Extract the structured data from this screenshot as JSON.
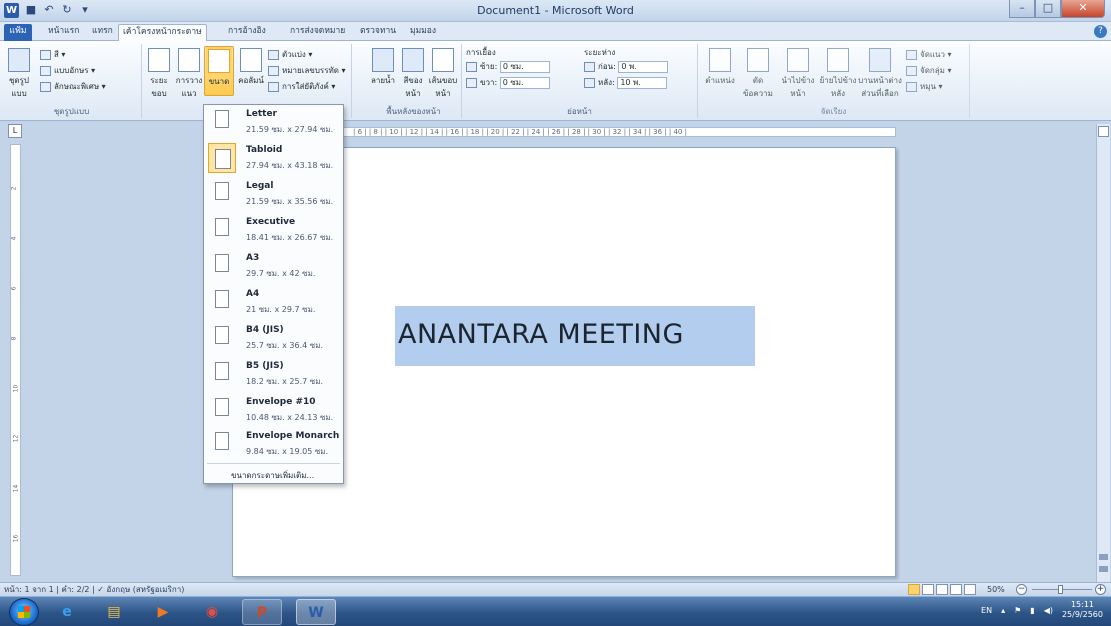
{
  "window": {
    "title": "Document1 - Microsoft Word",
    "icon": "word-app-icon"
  },
  "quick_access": [
    {
      "name": "save-icon",
      "glyph": "■"
    },
    {
      "name": "undo-icon",
      "glyph": "↶"
    },
    {
      "name": "redo-icon",
      "glyph": "↻"
    },
    {
      "name": "customize-qat-icon",
      "glyph": "▾"
    }
  ],
  "tabs": [
    {
      "id": "file",
      "label": "แฟ้ม"
    },
    {
      "id": "home",
      "label": "หน้าแรก"
    },
    {
      "id": "insert",
      "label": "แทรก"
    },
    {
      "id": "page-layout",
      "label": "เค้าโครงหน้ากระดาษ"
    },
    {
      "id": "references",
      "label": "การอ้างอิง"
    },
    {
      "id": "mailings",
      "label": "การส่งจดหมาย"
    },
    {
      "id": "review",
      "label": "ตรวจทาน"
    },
    {
      "id": "view",
      "label": "มุมมอง"
    }
  ],
  "ribbon": {
    "themes": {
      "label": "ชุดรูปแบบ",
      "themes_button": "ชุดรูปแบบ",
      "colors": "สี",
      "fonts": "แบบอักษร",
      "effects": "ลักษณะพิเศษ"
    },
    "page_setup": {
      "margins": "ระยะขอบ",
      "orientation": "การวางแนว",
      "size": "ขนาด",
      "columns": "คอลัมน์",
      "breaks": "ตัวแบ่ง",
      "line_numbers": "หมายเลขบรรทัด",
      "hyphenation": "การใส่ยัติภังค์"
    },
    "page_background": {
      "label": "พื้นหลังของหน้า",
      "watermark": "ลายน้ำ",
      "page_color": "สีของหน้า",
      "page_borders": "เส้นขอบหน้า"
    },
    "paragraph": {
      "label": "ย่อหน้า",
      "indent": "การเยื้อง",
      "left_label": "ซ้าย:",
      "left_value": "0 ซม.",
      "right_label": "ขวา:",
      "right_value": "0 ซม.",
      "spacing": "ระยะห่าง",
      "before_label": "ก่อน:",
      "before_value": "0 พ.",
      "after_label": "หลัง:",
      "after_value": "10 พ."
    },
    "arrange": {
      "label": "จัดเรียง",
      "position": "ตำแหน่ง",
      "wrap_text": "ตัดข้อความ",
      "bring_forward": "นำไปข้างหน้า",
      "send_backward": "ย้ายไปข้างหลัง",
      "selection_pane": "บานหน้าต่างส่วนที่เลือก",
      "align": "จัดแนว",
      "group": "จัดกลุ่ม",
      "rotate": "หมุน"
    }
  },
  "ruler": {
    "ticks": "| 6 |  | 8 |  | 10 |  | 12 |  | 14 |  | 16 |  | 18 |  | 20 |  | 22 |  | 24 |  | 26 |  | 28 |  | 30 |  | 32 |  | 34 |  | 36 |  | 40 |"
  },
  "document": {
    "text": "ANANTARA MEETING"
  },
  "size_menu": {
    "items": [
      {
        "name": "Letter",
        "dims": "21.59 ซม. x 27.94 ซม.",
        "selected": false
      },
      {
        "name": "Tabloid",
        "dims": "27.94 ซม. x 43.18 ซม.",
        "selected": true
      },
      {
        "name": "Legal",
        "dims": "21.59 ซม. x 35.56 ซม.",
        "selected": false
      },
      {
        "name": "Executive",
        "dims": "18.41 ซม. x 26.67 ซม.",
        "selected": false
      },
      {
        "name": "A3",
        "dims": "29.7 ซม. x 42 ซม.",
        "selected": false
      },
      {
        "name": "A4",
        "dims": "21 ซม. x 29.7 ซม.",
        "selected": false
      },
      {
        "name": "B4 (JIS)",
        "dims": "25.7 ซม. x 36.4 ซม.",
        "selected": false
      },
      {
        "name": "B5 (JIS)",
        "dims": "18.2 ซม. x 25.7 ซม.",
        "selected": false
      },
      {
        "name": "Envelope #10",
        "dims": "10.48 ซม. x 24.13 ซม.",
        "selected": false
      },
      {
        "name": "Envelope Monarch",
        "dims": "9.84 ซม. x 19.05 ซม.",
        "selected": false
      }
    ],
    "more": "ขนาดกระดาษเพิ่มเติม..."
  },
  "status": {
    "page": "หน้า: 1 จาก 1",
    "words": "คำ: 2/2",
    "language": "อังกฤษ (สหรัฐอเมริกา)",
    "zoom": "50%"
  },
  "taskbar": {
    "apps": [
      "internet-explorer-icon",
      "file-explorer-icon",
      "media-player-icon",
      "chrome-icon",
      "powerpoint-icon",
      "word-icon"
    ],
    "lang": "EN",
    "time": "15:11",
    "date": "25/9/2560"
  },
  "colors": {
    "accent": "#2d63b5",
    "selection": "#b2cdee",
    "highlight": "#ffd36b"
  }
}
